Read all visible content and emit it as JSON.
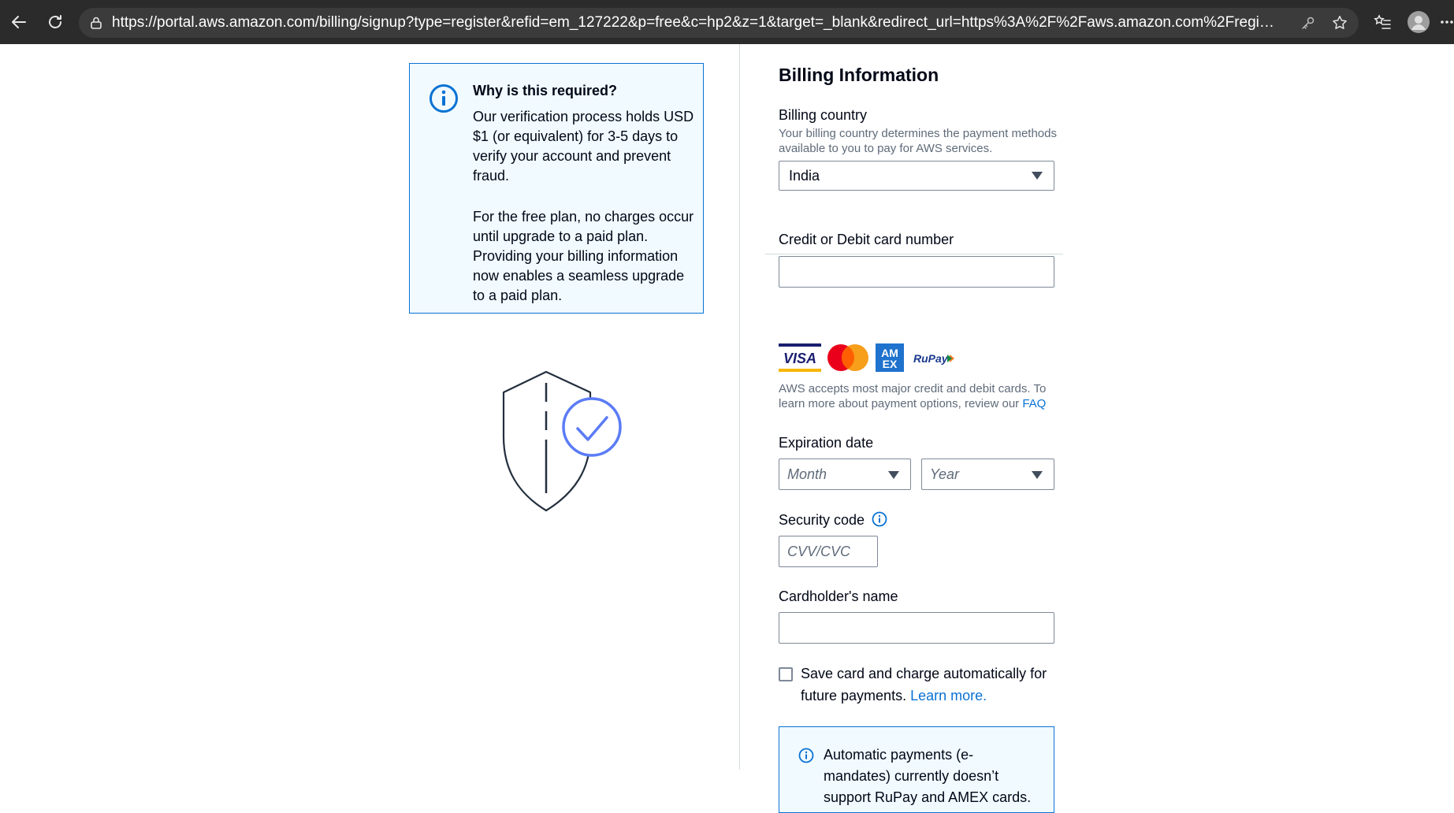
{
  "browser": {
    "url": "https://portal.aws.amazon.com/billing/signup?type=register&refid=em_127222&p=free&c=hp2&z=1&target=_blank&redirect_url=https%3A%2F%2Faws.amazon.com%2Fregistration-confirm..."
  },
  "info": {
    "title": "Why is this required?",
    "paragraph1": "Our verification process holds USD $1 (or equivalent) for 3-5 days to verify your account and prevent fraud.",
    "paragraph2": "For the free plan, no charges occur until upgrade to a paid plan. Providing your billing information now enables a seamless upgrade to a paid plan."
  },
  "form": {
    "title": "Billing Information",
    "billing_country_label": "Billing country",
    "billing_country_hint": "Your billing country determines the payment methods available to you to pay for AWS services.",
    "billing_country_value": "India",
    "card_number_label": "Credit or Debit card number",
    "card_number_value": "",
    "card_brands": [
      "VISA",
      "Mastercard",
      "AMEX",
      "RuPay"
    ],
    "cards_hint": "AWS accepts most major credit and debit cards. To learn more about payment options, review our",
    "faq_link": "FAQ",
    "expiration_label": "Expiration date",
    "month_placeholder": "Month",
    "year_placeholder": "Year",
    "security_code_label": "Security code",
    "security_code_placeholder": "CVV/CVC",
    "cardholder_label": "Cardholder's name",
    "cardholder_value": "",
    "save_card_label": "Save card and charge automatically for future payments.",
    "learn_more_link": "Learn more.",
    "save_card_checked": false,
    "notice_text": "Automatic payments (e-mandates) currently doesn’t support RuPay and AMEX cards."
  },
  "colors": {
    "accent": "#0972d3",
    "info_bg": "#f1faff",
    "browser_bar": "#2b2b2b"
  }
}
